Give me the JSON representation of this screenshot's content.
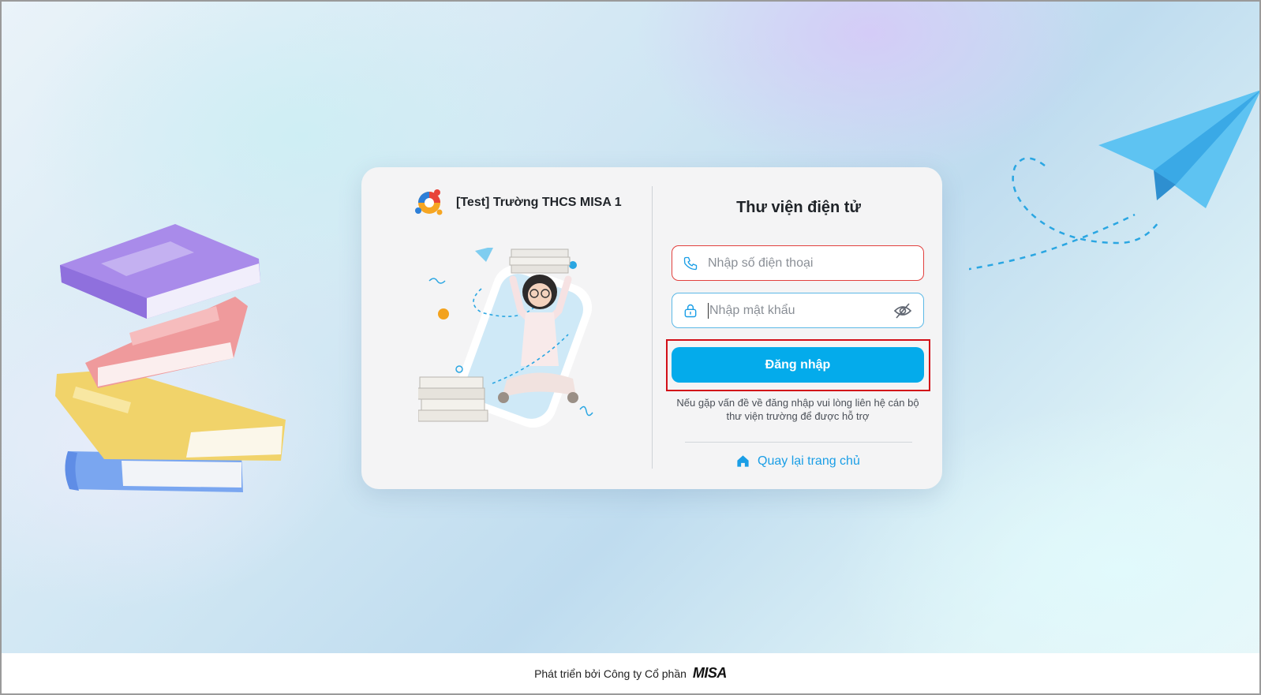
{
  "school": {
    "name": "[Test] Trường THCS MISA 1"
  },
  "login": {
    "title": "Thư viện điện tử",
    "phone_placeholder": "Nhập số điện thoại",
    "password_placeholder": "Nhập mật khẩu",
    "submit_label": "Đăng nhập",
    "help_text": "Nếu gặp vấn đề về đăng nhập vui lòng liên hệ cán bộ thư viện trường để được hỗ trợ",
    "home_link": "Quay lại trang chủ"
  },
  "footer": {
    "text": "Phát triển bởi Công ty Cổ phần",
    "brand": "MISA"
  },
  "colors": {
    "primary": "#04abeb",
    "error_border": "#e2403e",
    "focus_border": "#5bb8e6",
    "link": "#1a9ee6",
    "highlight": "#d20f18"
  },
  "icons": [
    "school-logo-icon",
    "phone-icon",
    "lock-icon",
    "eye-off-icon",
    "home-icon",
    "paper-plane-icon",
    "books-illustration"
  ]
}
